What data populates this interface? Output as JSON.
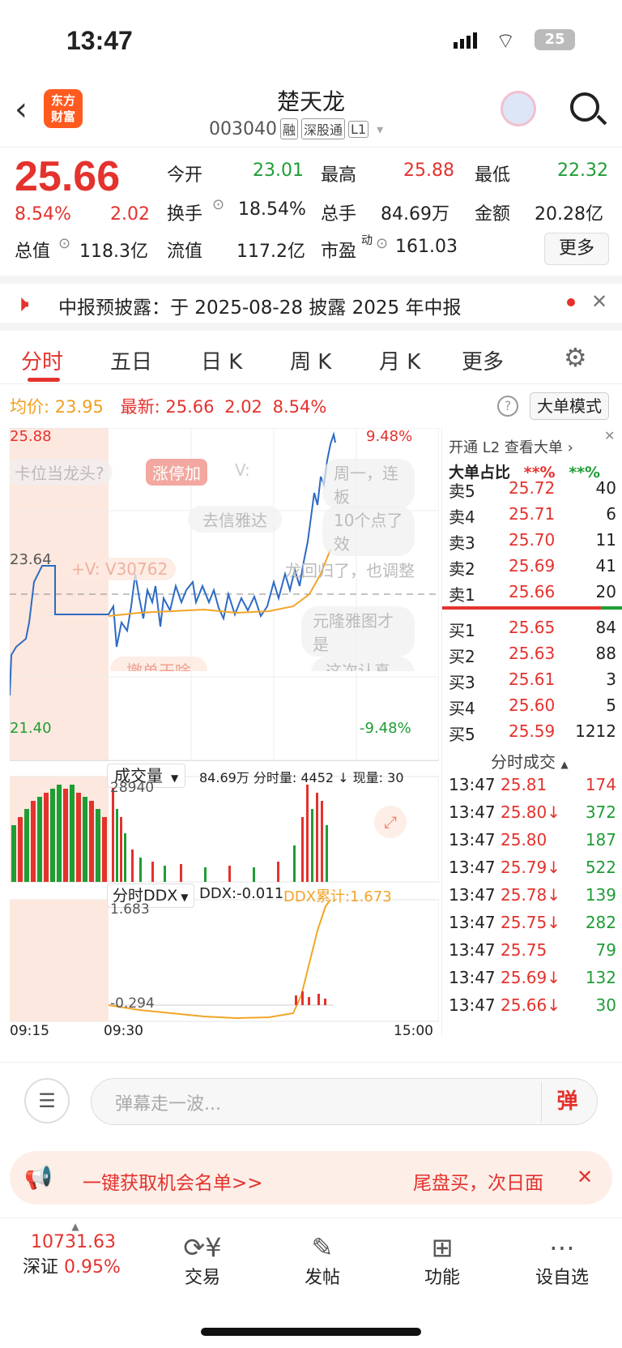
{
  "status": {
    "time": "13:47",
    "battery": "25"
  },
  "header": {
    "title": "楚天龙",
    "code": "003040",
    "tags": [
      "融",
      "深股通",
      "L1"
    ],
    "logo": "东方\n财富"
  },
  "quote": {
    "price": "25.66",
    "pct": "8.54%",
    "chg": "2.02",
    "open_label": "今开",
    "open": "23.01",
    "high_label": "最高",
    "high": "25.88",
    "low_label": "最低",
    "low": "22.32",
    "turnover_label": "换手",
    "turnover": "18.54%",
    "vol_label": "总手",
    "vol": "84.69万",
    "amt_label": "金额",
    "amt": "20.28亿",
    "mcap_label": "总值",
    "mcap": "118.3亿",
    "float_label": "流值",
    "float": "117.2亿",
    "pe_label": "市盈",
    "pe_sup": "动",
    "pe": "161.03",
    "more": "更多"
  },
  "notice": {
    "text": "中报预披露：于 2025-08-28 披露 2025 年中报"
  },
  "tabs": [
    "分时",
    "五日",
    "日 K",
    "周 K",
    "月 K",
    "更多"
  ],
  "chart_header": {
    "avg_label": "均价:",
    "avg": "23.95",
    "last_label": "最新:",
    "last": "25.66",
    "chg": "2.02",
    "pct": "8.54%",
    "mode": "大单模式"
  },
  "chart": {
    "top_price": "25.88",
    "top_pct": "9.48%",
    "mid_price": "23.64",
    "bot_price": "21.40",
    "bot_pct": "-9.48%",
    "danmaku": [
      "卡位当龙头?",
      "涨停加",
      "V:",
      "周一，连板",
      "去信雅达",
      "10个点了效",
      "+V: V30762",
      "龙回归了，也调整",
      "元隆雅图才是",
      "撤单干啥",
      "这次认真的"
    ],
    "vol_label": "成交量",
    "vol_info": "84.69万 分时量: 4452 ↓ 现量: 30",
    "vol_max": "28940",
    "ddx_label": "分时DDX",
    "ddx": "DDX:-0.011",
    "ddx_cum": "DDX累计:1.673",
    "ddx_max": "1.683",
    "ddx_min": "-0.294",
    "times": [
      "09:15",
      "09:30",
      "15:00"
    ]
  },
  "orderbook": {
    "banner": "开通 L2 查看大单",
    "ratio_label": "大单占比",
    "ratio1": "**%",
    "ratio2": "**%",
    "asks": [
      {
        "l": "卖5",
        "p": "25.72",
        "v": "40"
      },
      {
        "l": "卖4",
        "p": "25.71",
        "v": "6"
      },
      {
        "l": "卖3",
        "p": "25.70",
        "v": "11"
      },
      {
        "l": "卖2",
        "p": "25.69",
        "v": "41"
      },
      {
        "l": "卖1",
        "p": "25.66",
        "v": "20"
      }
    ],
    "bids": [
      {
        "l": "买1",
        "p": "25.65",
        "v": "84"
      },
      {
        "l": "买2",
        "p": "25.63",
        "v": "88"
      },
      {
        "l": "买3",
        "p": "25.61",
        "v": "3"
      },
      {
        "l": "买4",
        "p": "25.60",
        "v": "5"
      },
      {
        "l": "买5",
        "p": "25.59",
        "v": "1212"
      }
    ]
  },
  "ticks": {
    "title": "分时成交",
    "rows": [
      {
        "t": "13:47",
        "p": "25.81",
        "v": "174",
        "c": "red"
      },
      {
        "t": "13:47",
        "p": "25.80↓",
        "v": "372",
        "c": "green"
      },
      {
        "t": "13:47",
        "p": "25.80",
        "v": "187",
        "c": "green"
      },
      {
        "t": "13:47",
        "p": "25.79↓",
        "v": "522",
        "c": "green"
      },
      {
        "t": "13:47",
        "p": "25.78↓",
        "v": "139",
        "c": "green"
      },
      {
        "t": "13:47",
        "p": "25.75↓",
        "v": "282",
        "c": "green"
      },
      {
        "t": "13:47",
        "p": "25.75",
        "v": "79",
        "c": "green"
      },
      {
        "t": "13:47",
        "p": "25.69↓",
        "v": "132",
        "c": "green"
      },
      {
        "t": "13:47",
        "p": "25.66↓",
        "v": "30",
        "c": "green"
      }
    ]
  },
  "comment": {
    "placeholder": "弹幕走一波...",
    "send": "弹"
  },
  "promo": {
    "left": "一键获取机会名单>>",
    "right": "尾盘买，次日面"
  },
  "tabbar": {
    "index_val": "10731.63",
    "index_name": "深证",
    "index_pct": "0.95%",
    "items": [
      "交易",
      "发帖",
      "功能",
      "设自选"
    ]
  }
}
